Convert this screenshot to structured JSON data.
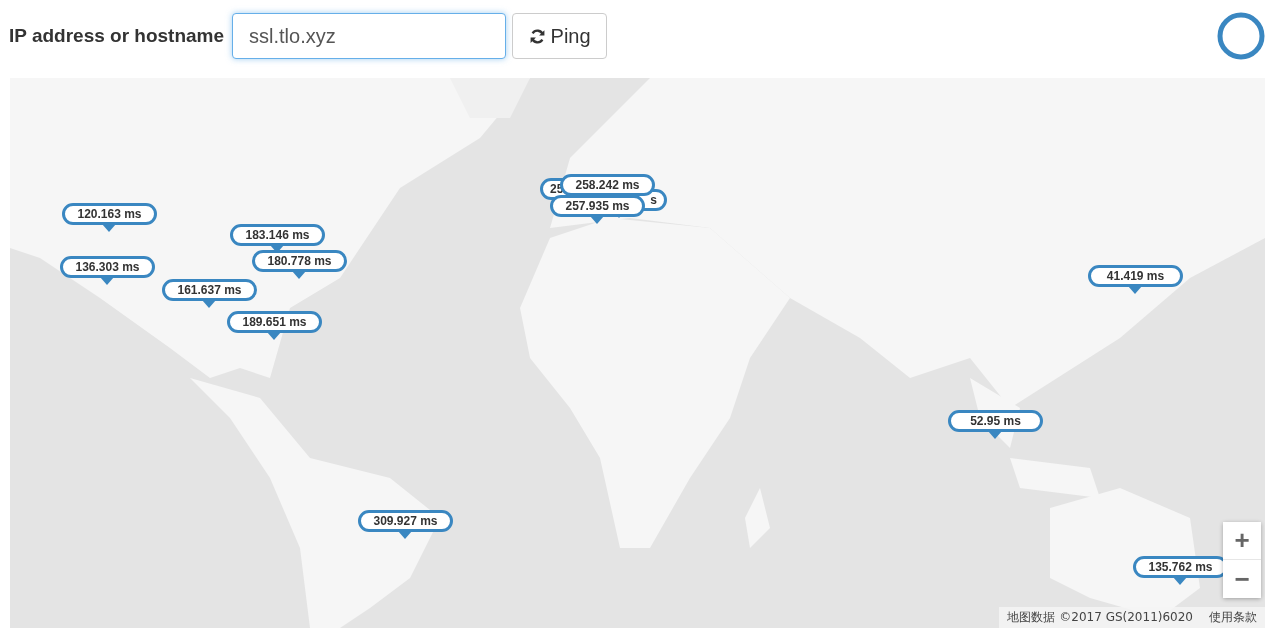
{
  "form": {
    "label": "IP address or hostname",
    "host_value": "ssl.tlo.xyz",
    "button": "Ping"
  },
  "map": {
    "kind": "picture",
    "markers": [
      {
        "text": "120.163 ms"
      },
      {
        "text": "183.146 ms"
      },
      {
        "text": "180.778 ms"
      },
      {
        "text": "136.303 ms"
      },
      {
        "text": "161.637 ms"
      },
      {
        "text": "189.651 ms"
      },
      {
        "text": "258.242 ms"
      },
      {
        "text": "25"
      },
      {
        "text": "s"
      },
      {
        "text": "257.935 ms"
      },
      {
        "text": "41.419 ms"
      },
      {
        "text": "52.95 ms"
      },
      {
        "text": "309.927 ms"
      },
      {
        "text": "135.762 ms"
      }
    ],
    "zoom_in": "+",
    "zoom_out": "−",
    "attribution": "地图数据 ©2017 GS(2011)6020",
    "terms": "使用条款"
  }
}
